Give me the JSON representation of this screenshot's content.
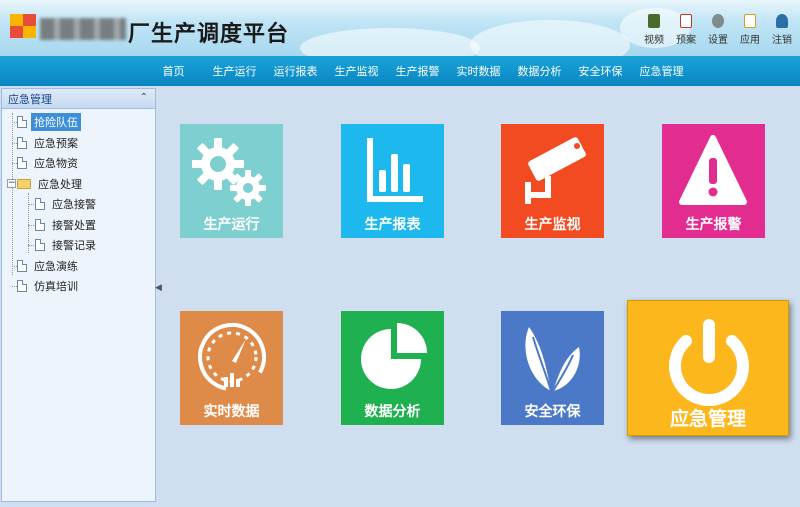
{
  "app": {
    "title": "厂生产调度平台"
  },
  "toolbar": [
    {
      "label": "视频",
      "icon": "video-icon",
      "color": "#4a6a2a"
    },
    {
      "label": "预案",
      "icon": "plan-icon",
      "color": "#c0392b"
    },
    {
      "label": "设置",
      "icon": "settings-icon",
      "color": "#7f8c8d"
    },
    {
      "label": "应用",
      "icon": "app-icon",
      "color": "#d4a017"
    },
    {
      "label": "注销",
      "icon": "logout-icon",
      "color": "#2c6fa8"
    }
  ],
  "nav": [
    "首页",
    "生产运行",
    "运行报表",
    "生产监视",
    "生产报警",
    "实时数据",
    "数据分析",
    "安全环保",
    "应急管理"
  ],
  "sidebar": {
    "title": "应急管理",
    "items": [
      "抢险队伍",
      "应急预案",
      "应急物资",
      "应急处理",
      "应急接警",
      "接警处置",
      "接警记录",
      "应急演练",
      "仿真培训"
    ]
  },
  "tiles": [
    {
      "label": "生产运行",
      "icon": "gears-icon",
      "color": "#7ecfd0"
    },
    {
      "label": "生产报表",
      "icon": "bar-chart-icon",
      "color": "#1cb8ee"
    },
    {
      "label": "生产监视",
      "icon": "camera-icon",
      "color": "#f24a21"
    },
    {
      "label": "生产报警",
      "icon": "warning-icon",
      "color": "#e32c8f"
    },
    {
      "label": "实时数据",
      "icon": "gauge-icon",
      "color": "#de8b4a"
    },
    {
      "label": "数据分析",
      "icon": "pie-chart-icon",
      "color": "#1fb04f"
    },
    {
      "label": "安全环保",
      "icon": "leaf-icon",
      "color": "#4b79c8"
    },
    {
      "label": "应急管理",
      "icon": "power-icon",
      "color": "#fcb71d"
    }
  ]
}
